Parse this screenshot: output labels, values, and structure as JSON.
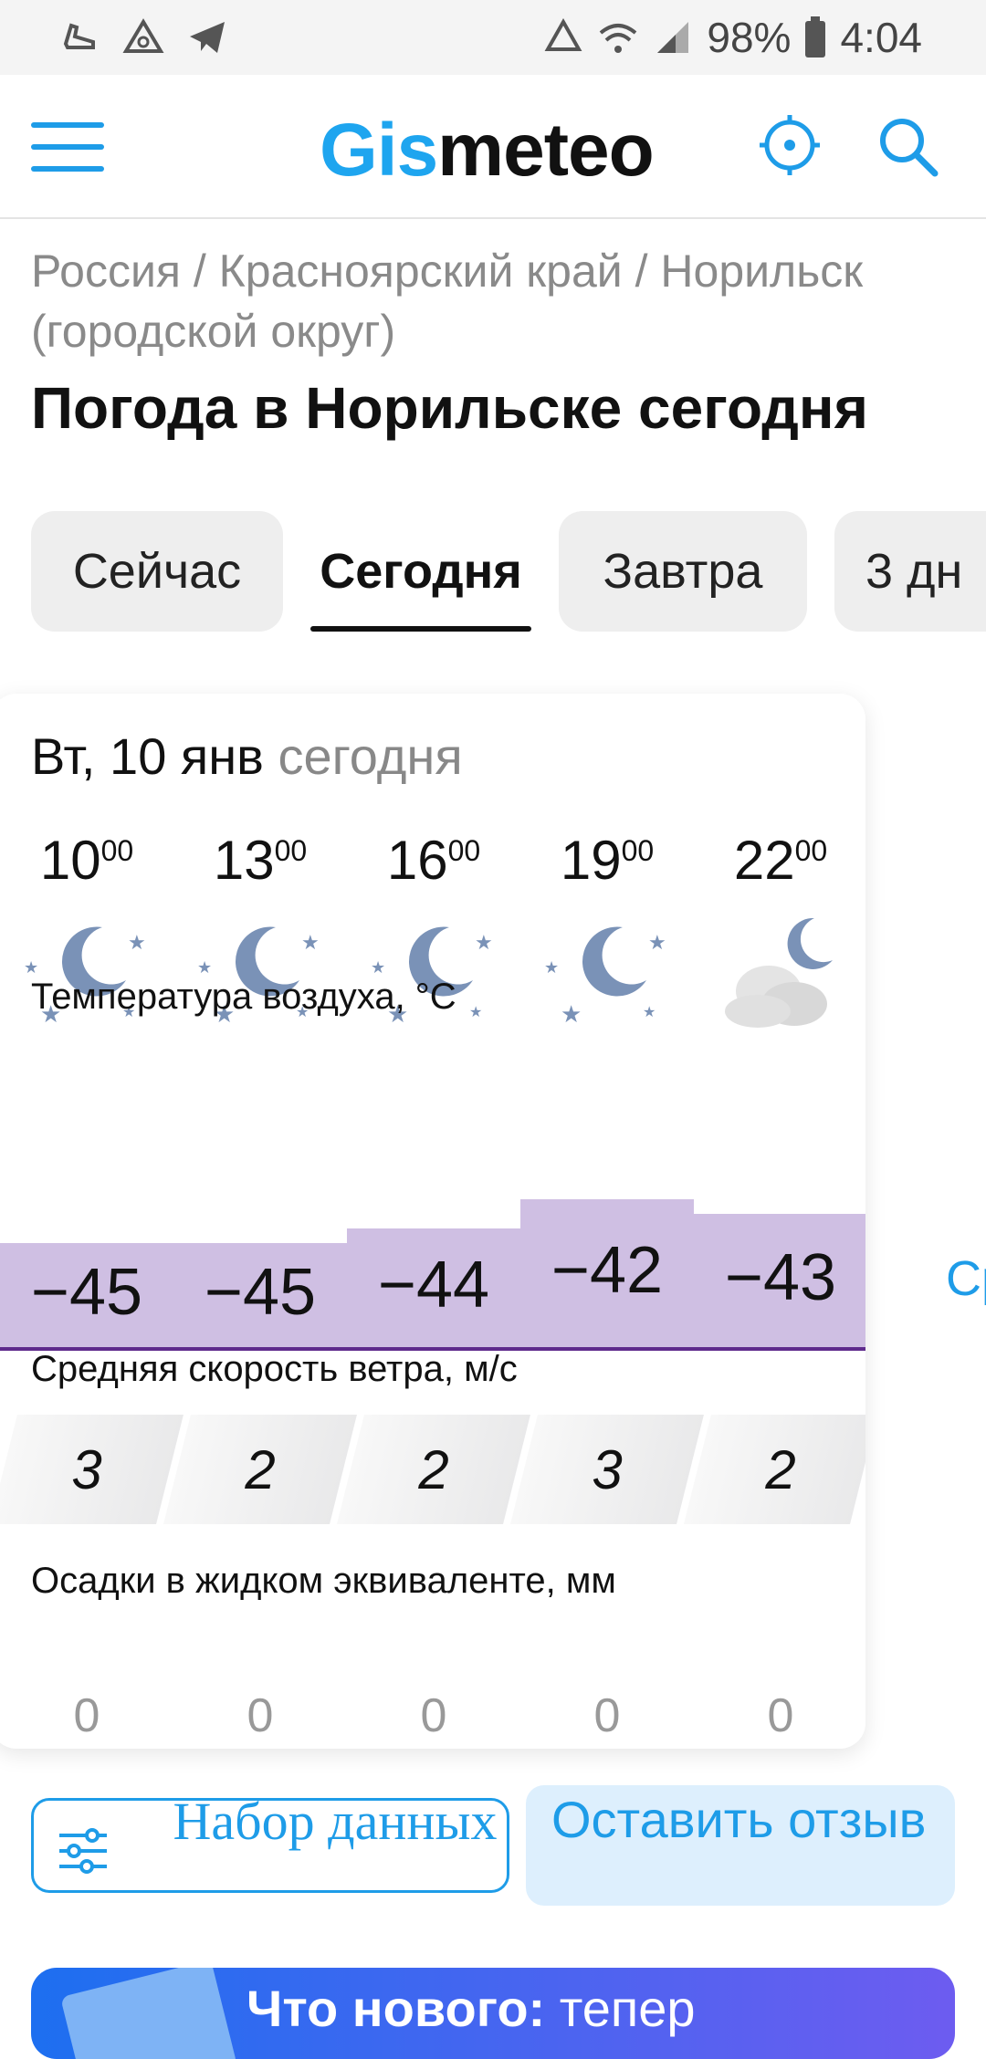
{
  "status_bar": {
    "battery": "98%",
    "time": "4:04"
  },
  "header": {
    "logo_part1": "Gis",
    "logo_part2": "meteo"
  },
  "breadcrumb": "Россия / Красноярский край / Норильск (городской округ)",
  "title": "Погода в Норильске сегодня",
  "tabs": [
    {
      "label": "Сейчас",
      "active": false
    },
    {
      "label": "Сегодня",
      "active": true
    },
    {
      "label": "Завтра",
      "active": false
    },
    {
      "label": "3 дн",
      "active": false
    }
  ],
  "card": {
    "date": "Вт, 10 янв",
    "date_sub": "сегодня",
    "hours": [
      {
        "h": "10",
        "m": "00"
      },
      {
        "h": "13",
        "m": "00"
      },
      {
        "h": "16",
        "m": "00"
      },
      {
        "h": "19",
        "m": "00"
      },
      {
        "h": "22",
        "m": "00"
      }
    ],
    "icons": [
      "moon-stars-icon",
      "moon-stars-icon",
      "moon-stars-icon",
      "moon-stars-icon",
      "moon-cloud-icon"
    ],
    "temp_label": "Температура воздуха, °C",
    "temps": [
      "−45",
      "−45",
      "−44",
      "−42",
      "−43"
    ],
    "temp_values": [
      -45,
      -45,
      -44,
      -42,
      -43
    ],
    "wind_label": "Средняя скорость ветра, м/с",
    "wind": [
      "3",
      "2",
      "2",
      "3",
      "2"
    ],
    "precip_label": "Осадки в жидком эквиваленте, мм",
    "precip": [
      "0",
      "0",
      "0",
      "0",
      "0"
    ]
  },
  "side_link": "Ср",
  "buttons": {
    "data_set": "Набор данных",
    "feedback": "Оставить отзыв"
  },
  "promo": {
    "bold": "Что нового:",
    "rest": " тепер"
  },
  "colors": {
    "accent": "#1e9ce8",
    "temp_bar": "#cfbfe3",
    "temp_line": "#5e2a8c",
    "moon": "#7a92b7"
  }
}
